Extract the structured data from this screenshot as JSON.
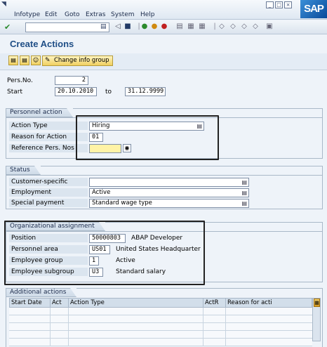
{
  "menu": {
    "items": [
      "Infotype",
      "Edit",
      "Goto",
      "Extras",
      "System",
      "Help"
    ]
  },
  "brand": {
    "logo_text": "SAP"
  },
  "title": "Create Actions",
  "app_toolbar": {
    "change_label": "Change info group"
  },
  "header_fields": {
    "pers_no_label": "Pers.No.",
    "pers_no_value": "2",
    "start_label": "Start",
    "start_value": "20.10.2010",
    "to_label": "to",
    "end_value": "31.12.9999"
  },
  "personnel_action": {
    "title": "Personnel action",
    "action_type_label": "Action Type",
    "action_type_value": "Hiring",
    "reason_label": "Reason for Action",
    "reason_value": "01",
    "ref_label": "Reference Pers. Nos",
    "ref_value": ""
  },
  "status": {
    "title": "Status",
    "customer_label": "Customer-specific",
    "customer_value": "",
    "employment_label": "Employment",
    "employment_value": "Active",
    "special_label": "Special payment",
    "special_value": "Standard wage type"
  },
  "org_assignment": {
    "title": "Organizational assignment",
    "position_label": "Position",
    "position_value": "50000803",
    "position_text": "ABAP Developer",
    "area_label": "Personnel area",
    "area_value": "US01",
    "area_text": "United States Headquarter",
    "group_label": "Employee group",
    "group_value": "1",
    "group_text": "Active",
    "subgroup_label": "Employee subgroup",
    "subgroup_value": "U3",
    "subgroup_text": "Standard salary"
  },
  "additional_actions": {
    "title": "Additional actions",
    "columns": [
      "Start Date",
      "Act",
      "Action Type",
      "ActR",
      "Reason for acti"
    ]
  },
  "colors": {
    "accent": "#1f4e86",
    "field_required": "#fff3a6",
    "background": "#eef3f9"
  }
}
